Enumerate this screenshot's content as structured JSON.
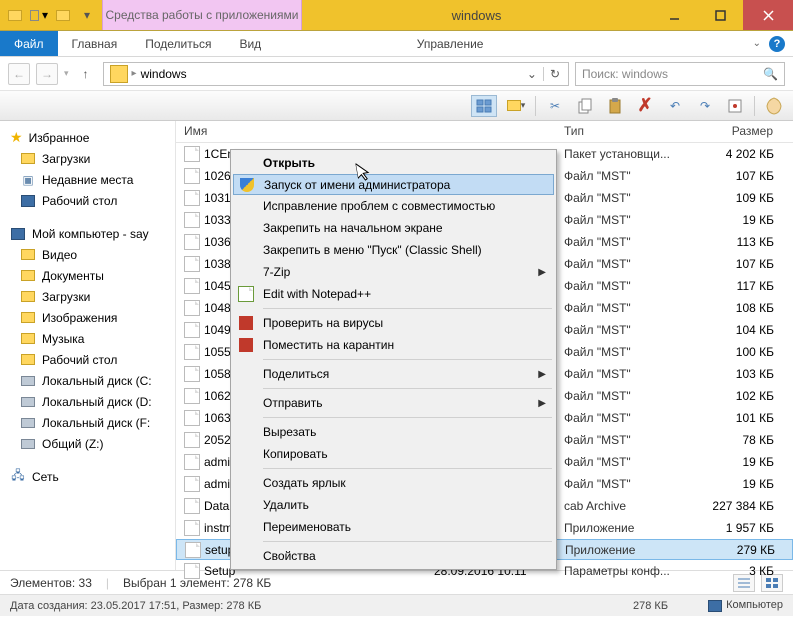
{
  "window": {
    "tab_group": "Средства работы с приложениями",
    "title": "windows"
  },
  "ribbon": {
    "file": "Файл",
    "tabs": [
      "Главная",
      "Поделиться",
      "Вид"
    ],
    "contextual": "Управление"
  },
  "nav": {
    "crumb": "windows",
    "search_placeholder": "Поиск: windows"
  },
  "navpane": {
    "favorites": {
      "header": "Избранное",
      "items": [
        "Загрузки",
        "Недавние места",
        "Рабочий стол"
      ]
    },
    "computer": {
      "header": "Мой компьютер - say",
      "items": [
        "Видео",
        "Документы",
        "Загрузки",
        "Изображения",
        "Музыка",
        "Рабочий стол",
        "Локальный диск (C:",
        "Локальный диск (D:",
        "Локальный диск (F:",
        "Общий (Z:)"
      ]
    },
    "network": {
      "header": "Сеть"
    }
  },
  "columns": {
    "name": "Имя",
    "date": "",
    "type": "Тип",
    "size": "Размер"
  },
  "files": [
    {
      "name": "1CEnt",
      "type": "Пакет установщи...",
      "size": "4 202 КБ"
    },
    {
      "name": "1026.",
      "type": "Файл \"MST\"",
      "size": "107 КБ"
    },
    {
      "name": "1031.",
      "type": "Файл \"MST\"",
      "size": "109 КБ"
    },
    {
      "name": "1033.",
      "type": "Файл \"MST\"",
      "size": "19 КБ"
    },
    {
      "name": "1036.",
      "type": "Файл \"MST\"",
      "size": "113 КБ"
    },
    {
      "name": "1038.",
      "type": "Файл \"MST\"",
      "size": "107 КБ"
    },
    {
      "name": "1045.",
      "type": "Файл \"MST\"",
      "size": "117 КБ"
    },
    {
      "name": "1048.",
      "type": "Файл \"MST\"",
      "size": "108 КБ"
    },
    {
      "name": "1049.",
      "type": "Файл \"MST\"",
      "size": "104 КБ"
    },
    {
      "name": "1055.",
      "type": "Файл \"MST\"",
      "size": "100 КБ"
    },
    {
      "name": "1058.",
      "type": "Файл \"MST\"",
      "size": "103 КБ"
    },
    {
      "name": "1062.",
      "type": "Файл \"MST\"",
      "size": "102 КБ"
    },
    {
      "name": "1063.",
      "type": "Файл \"MST\"",
      "size": "101 КБ"
    },
    {
      "name": "2052.",
      "type": "Файл \"MST\"",
      "size": "78 КБ"
    },
    {
      "name": "admin",
      "type": "Файл \"MST\"",
      "size": "19 КБ"
    },
    {
      "name": "admin",
      "type": "Файл \"MST\"",
      "size": "19 КБ"
    },
    {
      "name": "Data1",
      "type": "cab Archive",
      "size": "227 384 КБ"
    },
    {
      "name": "instm",
      "type": "Приложение",
      "size": "1 957 КБ"
    },
    {
      "name": "setup",
      "type": "Приложение",
      "size": "279 КБ",
      "selected": true
    },
    {
      "name": "Setup",
      "date": "28.09.2016 10:11",
      "type": "Параметры конф...",
      "size": "3 КБ"
    }
  ],
  "context_menu": [
    {
      "label": "Открыть",
      "bold": true
    },
    {
      "label": "Запуск от имени администратора",
      "hover": true,
      "icon": "shield"
    },
    {
      "label": "Исправление проблем с совместимостью"
    },
    {
      "label": "Закрепить на начальном экране"
    },
    {
      "label": "Закрепить в меню \"Пуск\" (Classic Shell)"
    },
    {
      "label": "7-Zip",
      "sub": true
    },
    {
      "label": "Edit with Notepad++",
      "icon": "notepad"
    },
    {
      "sep": true
    },
    {
      "label": "Проверить на вирусы",
      "icon": "av"
    },
    {
      "label": "Поместить на карантин",
      "icon": "av"
    },
    {
      "sep": true
    },
    {
      "label": "Поделиться",
      "sub": true
    },
    {
      "sep": true
    },
    {
      "label": "Отправить",
      "sub": true
    },
    {
      "sep": true
    },
    {
      "label": "Вырезать"
    },
    {
      "label": "Копировать"
    },
    {
      "sep": true
    },
    {
      "label": "Создать ярлык"
    },
    {
      "label": "Удалить"
    },
    {
      "label": "Переименовать"
    },
    {
      "sep": true
    },
    {
      "label": "Свойства"
    }
  ],
  "status": {
    "count": "Элементов: 33",
    "selection": "Выбран 1 элемент: 278 КБ"
  },
  "status2": {
    "left": "Дата создания: 23.05.2017 17:51, Размер: 278 КБ",
    "size": "278 КБ",
    "location": "Компьютер"
  }
}
